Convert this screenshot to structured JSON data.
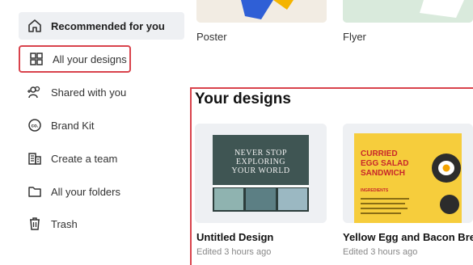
{
  "sidebar": {
    "items": [
      {
        "label": "Recommended for you",
        "icon": "home-icon"
      },
      {
        "label": "All your designs",
        "icon": "designs-grid-icon"
      },
      {
        "label": "Shared with you",
        "icon": "shared-users-icon"
      },
      {
        "label": "Brand Kit",
        "icon": "brand-kit-icon"
      },
      {
        "label": "Create a team",
        "icon": "team-building-icon"
      },
      {
        "label": "All your folders",
        "icon": "folder-icon"
      },
      {
        "label": "Trash",
        "icon": "trash-icon"
      }
    ]
  },
  "templates": [
    {
      "label": "Poster"
    },
    {
      "label": "Flyer"
    }
  ],
  "your_designs": {
    "title": "Your designs",
    "cards": [
      {
        "title": "Untitled Design",
        "meta": "Edited 3 hours ago",
        "thumb_text": [
          "NEVER STOP",
          "EXPLORING",
          "YOUR WORLD"
        ]
      },
      {
        "title": "Yellow Egg and Bacon Bre...",
        "meta": "Edited 3 hours ago",
        "thumb_text": [
          "CURRIED",
          "EGG SALAD",
          "SANDWICH"
        ],
        "thumb_subheading": "INGREDIENTS"
      }
    ]
  },
  "colors": {
    "highlight": "#d9434c",
    "active_bg": "#eef0f3",
    "flyer_yellow": "#f6cd3c",
    "accent_red": "#c8262b"
  }
}
